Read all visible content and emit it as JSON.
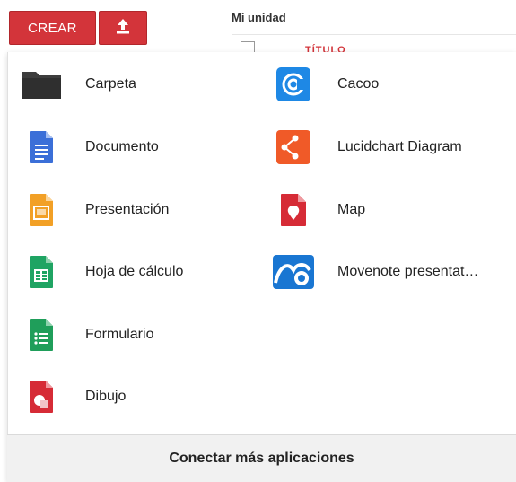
{
  "toolbar": {
    "create_label": "CREAR",
    "upload_icon": "upload-icon",
    "location_title": "Mi unidad",
    "column_title_partial": "TÍTULO"
  },
  "menu": {
    "left": [
      {
        "label": "Carpeta",
        "icon": "folder-icon"
      },
      {
        "label": "Documento",
        "icon": "docs-icon"
      },
      {
        "label": "Presentación",
        "icon": "slides-icon"
      },
      {
        "label": "Hoja de cálculo",
        "icon": "sheets-icon"
      },
      {
        "label": "Formulario",
        "icon": "forms-icon"
      },
      {
        "label": "Dibujo",
        "icon": "drawing-icon"
      }
    ],
    "right": [
      {
        "label": "Cacoo",
        "icon": "cacoo-icon"
      },
      {
        "label": "Lucidchart Diagram",
        "icon": "lucidchart-icon"
      },
      {
        "label": "Map",
        "icon": "map-icon"
      },
      {
        "label": "Movenote presentat…",
        "icon": "movenote-icon"
      }
    ],
    "footer_label": "Conectar más aplicaciones"
  },
  "colors": {
    "accent_red": "#d3343a",
    "docs_blue": "#3b6fd8",
    "slides_orange": "#f2a026",
    "sheets_green": "#1fa463",
    "cacoo_blue": "#1e88e5",
    "lucid_orange": "#f05a28",
    "map_red": "#d62b36",
    "movenote_blue": "#1976d2"
  }
}
